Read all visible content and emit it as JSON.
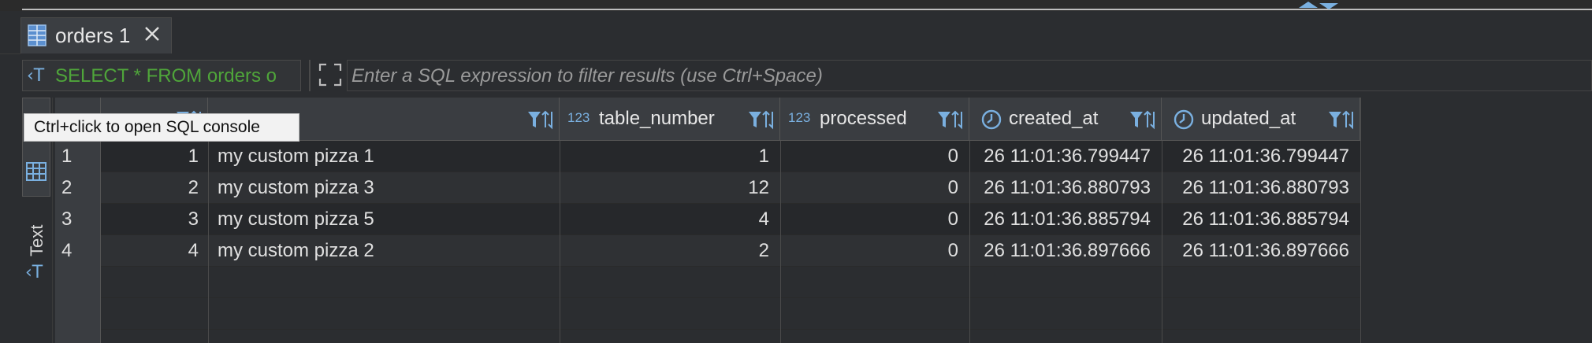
{
  "tab": {
    "title": "orders 1"
  },
  "filter": {
    "query": "SELECT * FROM orders o",
    "placeholder": "Enter a SQL expression to filter results (use Ctrl+Space)"
  },
  "side_panel": {
    "grid_label": "G",
    "text_label": "Text"
  },
  "tooltip": "Ctrl+click to open SQL console",
  "columns": [
    {
      "name": "",
      "type": ""
    },
    {
      "name": "",
      "type": ""
    },
    {
      "name": "table_number",
      "type": "123"
    },
    {
      "name": "processed",
      "type": "123"
    },
    {
      "name": "created_at",
      "type": "clock"
    },
    {
      "name": "updated_at",
      "type": "clock"
    }
  ],
  "rows": [
    {
      "num": "1",
      "id": "1",
      "name": "my custom pizza 1",
      "table_number": "1",
      "processed": "0",
      "created_at": "26 11:01:36.799447",
      "updated_at": "26 11:01:36.799447"
    },
    {
      "num": "2",
      "id": "2",
      "name": "my custom pizza 3",
      "table_number": "12",
      "processed": "0",
      "created_at": "26 11:01:36.880793",
      "updated_at": "26 11:01:36.880793"
    },
    {
      "num": "3",
      "id": "3",
      "name": "my custom pizza 5",
      "table_number": "4",
      "processed": "0",
      "created_at": "26 11:01:36.885794",
      "updated_at": "26 11:01:36.885794"
    },
    {
      "num": "4",
      "id": "4",
      "name": "my custom pizza 2",
      "table_number": "2",
      "processed": "0",
      "created_at": "26 11:01:36.897666",
      "updated_at": "26 11:01:36.897666"
    }
  ],
  "colors": {
    "query_green": "#4fa53a",
    "accent_blue": "#7ab0e0"
  }
}
